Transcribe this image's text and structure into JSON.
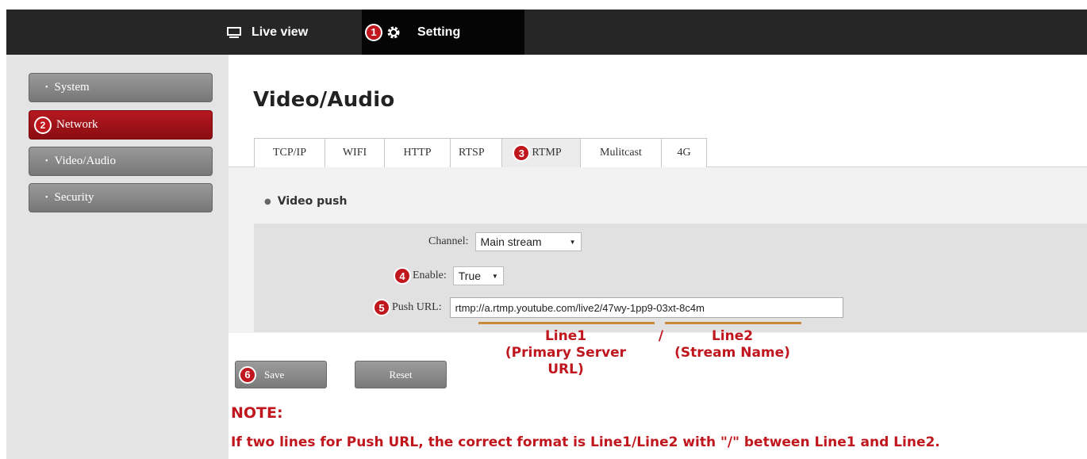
{
  "topnav": {
    "live_view": "Live view",
    "setting": "Setting",
    "marker": "1"
  },
  "sidebar": {
    "items": [
      {
        "label": "System"
      },
      {
        "label": "Network",
        "marker": "2"
      },
      {
        "label": "Video/Audio"
      },
      {
        "label": "Security"
      }
    ]
  },
  "main": {
    "title": "Video/Audio",
    "tabs": [
      "TCP/IP",
      "WIFI",
      "HTTP",
      "RTSP",
      "RTMP",
      "Mulitcast",
      "4G"
    ],
    "tab_marker": "3",
    "section": "Video push",
    "form": {
      "channel_label": "Channel:",
      "channel_value": "Main stream",
      "enable_label": "Enable:",
      "enable_value": "True",
      "enable_marker": "4",
      "url_label": "Push URL:",
      "url_value": "rtmp://a.rtmp.youtube.com/live2/47wy-1pp9-03xt-8c4m",
      "url_marker": "5"
    },
    "annotations": {
      "line1": "Line1",
      "line1_sub": "(Primary Server URL)",
      "slash": "/",
      "line2": "Line2",
      "line2_sub": "(Stream Name)"
    },
    "buttons": {
      "save": "Save",
      "save_marker": "6",
      "reset": "Reset"
    },
    "note_title": "NOTE:",
    "note_text": "If two lines for Push URL, the correct format is Line1/Line2 with \"/\" between Line1 and Line2."
  },
  "colors": {
    "accent_red": "#c0161e",
    "topbar": "#262626",
    "underline": "#c88a3a"
  }
}
